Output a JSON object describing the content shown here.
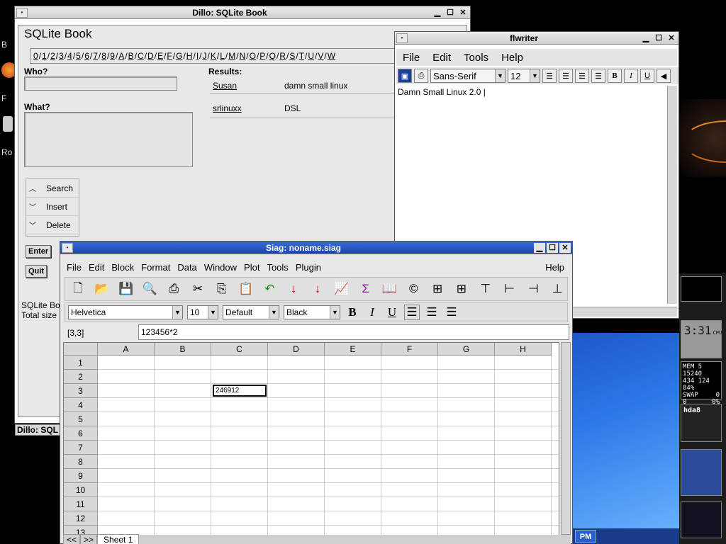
{
  "dillo": {
    "title": "Dillo: SQLite Book",
    "heading": "SQLite Book",
    "alpha_links": [
      "0",
      "1",
      "2",
      "3",
      "4",
      "5",
      "6",
      "7",
      "8",
      "9",
      "A",
      "B",
      "C",
      "D",
      "E",
      "F",
      "G",
      "H",
      "I",
      "J",
      "K",
      "L",
      "M",
      "N",
      "O",
      "P",
      "Q",
      "R",
      "S",
      "T",
      "U",
      "V",
      "W"
    ],
    "who_label": "Who?",
    "what_label": "What?",
    "results_label": "Results:",
    "results": [
      {
        "name": "Susan",
        "value": "damn small linux"
      },
      {
        "name": "srlinuxx",
        "value": "DSL"
      }
    ],
    "buttons": [
      "Search",
      "Insert",
      "Delete"
    ],
    "enter_label": "Enter",
    "quit_label": "Quit",
    "footer_line1": "SQLite Bo",
    "footer_line2": "Total size",
    "status_text": "Dillo: SQL"
  },
  "flwriter": {
    "title": "flwriter",
    "menu": [
      "File",
      "Edit",
      "Tools",
      "Help"
    ],
    "font": "Sans-Serif",
    "size": "12",
    "bold": "B",
    "italic": "I",
    "underline": "U",
    "text": "Damn Small Linux 2.0 |"
  },
  "siag": {
    "title": "Siag: noname.siag",
    "menu": [
      "File",
      "Edit",
      "Block",
      "Format",
      "Data",
      "Window",
      "Plot",
      "Tools",
      "Plugin"
    ],
    "help": "Help",
    "font": "Helvetica",
    "size": "10",
    "style": "Default",
    "color": "Black",
    "bold": "B",
    "italic": "I",
    "underline": "U",
    "cell_ref": "[3,3]",
    "formula": "123456*2",
    "columns": [
      "A",
      "B",
      "C",
      "D",
      "E",
      "F",
      "G",
      "H"
    ],
    "rows": [
      "1",
      "2",
      "3",
      "4",
      "5",
      "6",
      "7",
      "8",
      "9",
      "10",
      "11",
      "12",
      "13"
    ],
    "active_cell_value": "246912",
    "tab_first": "<<",
    "tab_next": ">>",
    "sheet_tab": "Sheet 1"
  },
  "desktop": {
    "label_f": "F",
    "label_ro": "Ro",
    "label_b": "B",
    "taskbar_pm": "PM"
  },
  "dock": {
    "cpu_label": "CPU",
    "clock": "3:31",
    "mem": "MEM 5 15240",
    "mem2": "434 124 84%",
    "swap": "SWAP",
    "swap_val": "0",
    "zero": "0",
    "zero_pct": "0%",
    "disk": "hda8"
  }
}
